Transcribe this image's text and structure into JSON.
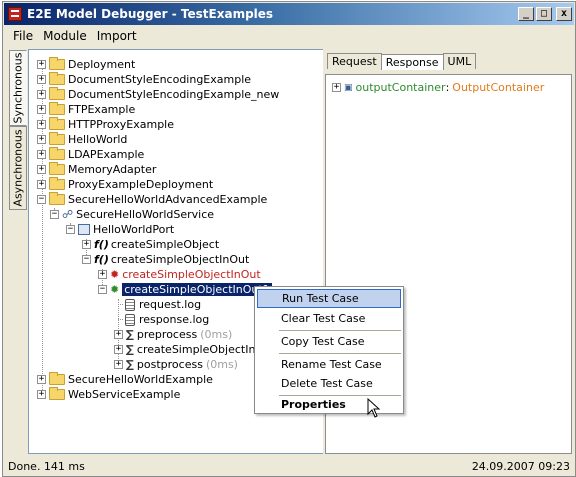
{
  "window": {
    "title": "E2E Model Debugger - TestExamples",
    "minimize_label": "_",
    "maximize_label": "□",
    "close_label": "x"
  },
  "menubar": {
    "items": [
      {
        "label": "File"
      },
      {
        "label": "Module"
      },
      {
        "label": "Import"
      }
    ]
  },
  "side_tabs": [
    {
      "label": "Synchronous",
      "active": true
    },
    {
      "label": "Asynchronous",
      "active": false
    }
  ],
  "tree": {
    "expand_symbol": "+",
    "collapse_symbol": "−",
    "items": [
      {
        "label": "Deployment",
        "kind": "folder"
      },
      {
        "label": "DocumentStyleEncodingExample",
        "kind": "folder"
      },
      {
        "label": "DocumentStyleEncodingExample_new",
        "kind": "folder"
      },
      {
        "label": "FTPExample",
        "kind": "folder"
      },
      {
        "label": "HTTPProxyExample",
        "kind": "folder"
      },
      {
        "label": "HelloWorld",
        "kind": "folder"
      },
      {
        "label": "LDAPExample",
        "kind": "folder"
      },
      {
        "label": "MemoryAdapter",
        "kind": "folder"
      },
      {
        "label": "ProxyExampleDeployment",
        "kind": "folder"
      },
      {
        "label": "SecureHelloWorldAdvancedExample",
        "kind": "folder"
      },
      {
        "label": "SecureHelloWorldService",
        "kind": "service"
      },
      {
        "label": "HelloWorldPort",
        "kind": "port"
      },
      {
        "label": "createSimpleObject",
        "kind": "operation",
        "icon": "f()"
      },
      {
        "label": "createSimpleObjectInOut",
        "kind": "operation",
        "icon": "f()"
      },
      {
        "label": "createSimpleObjectInOut",
        "kind": "testcase-failed"
      },
      {
        "label": "createSimpleObjectInOut1",
        "kind": "testcase-selected"
      },
      {
        "label": "request.log",
        "kind": "log"
      },
      {
        "label": "response.log",
        "kind": "log"
      },
      {
        "label": "preprocess",
        "kind": "step",
        "timing": "(0ms)"
      },
      {
        "label": "createSimpleObjectInOut",
        "kind": "step",
        "timing": ""
      },
      {
        "label": "postprocess",
        "kind": "step",
        "timing": "(0ms)"
      },
      {
        "label": "SecureHelloWorldExample",
        "kind": "folder"
      },
      {
        "label": "WebServiceExample",
        "kind": "folder"
      }
    ]
  },
  "right_panel": {
    "tabs": [
      {
        "label": "Request",
        "active": false
      },
      {
        "label": "Response",
        "active": true
      },
      {
        "label": "UML",
        "active": false
      }
    ],
    "response_tree": {
      "name": "outputContainer",
      "separator": ":",
      "type": "OutputContainer"
    }
  },
  "context_menu": {
    "items": [
      {
        "label": "Run Test Case",
        "highlight": true
      },
      {
        "label": "Clear Test Case"
      },
      {
        "label": "Copy Test Case"
      },
      {
        "label": "Rename Test Case"
      },
      {
        "label": "Delete Test Case"
      },
      {
        "label": "Properties",
        "bold": true
      }
    ]
  },
  "status": {
    "left": "Done. 141 ms",
    "right": "24.09.2007 09:23"
  },
  "colors": {
    "title_gradient_start": "#0a246a",
    "selection": "#0a246a",
    "menu_highlight": "#c1d2ee",
    "error_red": "#c0241f",
    "ok_green": "#2e8b2e",
    "type_orange": "#e07b1a"
  }
}
